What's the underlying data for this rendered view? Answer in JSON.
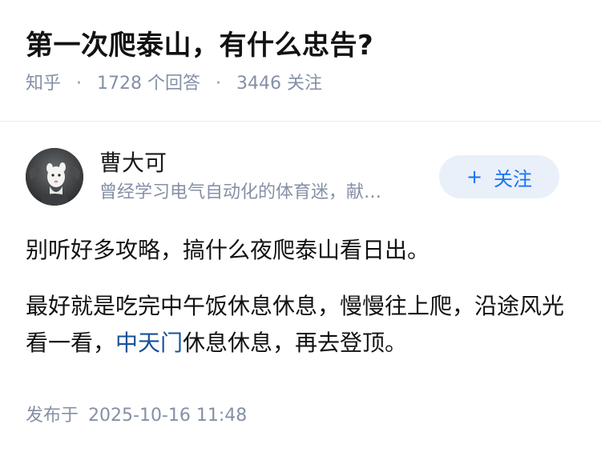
{
  "question": {
    "title": "第一次爬泰山，有什么忠告?",
    "source": "知乎",
    "separator": "·",
    "answer_count": "1728",
    "answer_label": "个回答",
    "follower_count": "3446",
    "follower_label": "关注"
  },
  "author": {
    "name": "曹大可",
    "bio": "曾经学习电气自动化的体育迷，献…",
    "avatar_icon": "cartoon-avatar-icon",
    "follow_plus": "+",
    "follow_label": "关注"
  },
  "answer": {
    "para1": "别听好多攻略，搞什么夜爬泰山看日出。",
    "para2_before": "最好就是吃完中午饭休息休息，慢慢往上爬，沿途风光看一看，",
    "para2_link": "中天门",
    "para2_after": "休息休息，再去登顶。"
  },
  "footer": {
    "published_label": "发布于",
    "published_time": "2025-10-16 11:48"
  },
  "colors": {
    "meta_gray": "#8590a6",
    "brand_blue": "#1772f6",
    "link_blue": "#175199",
    "follow_bg": "#e9f0fa"
  }
}
